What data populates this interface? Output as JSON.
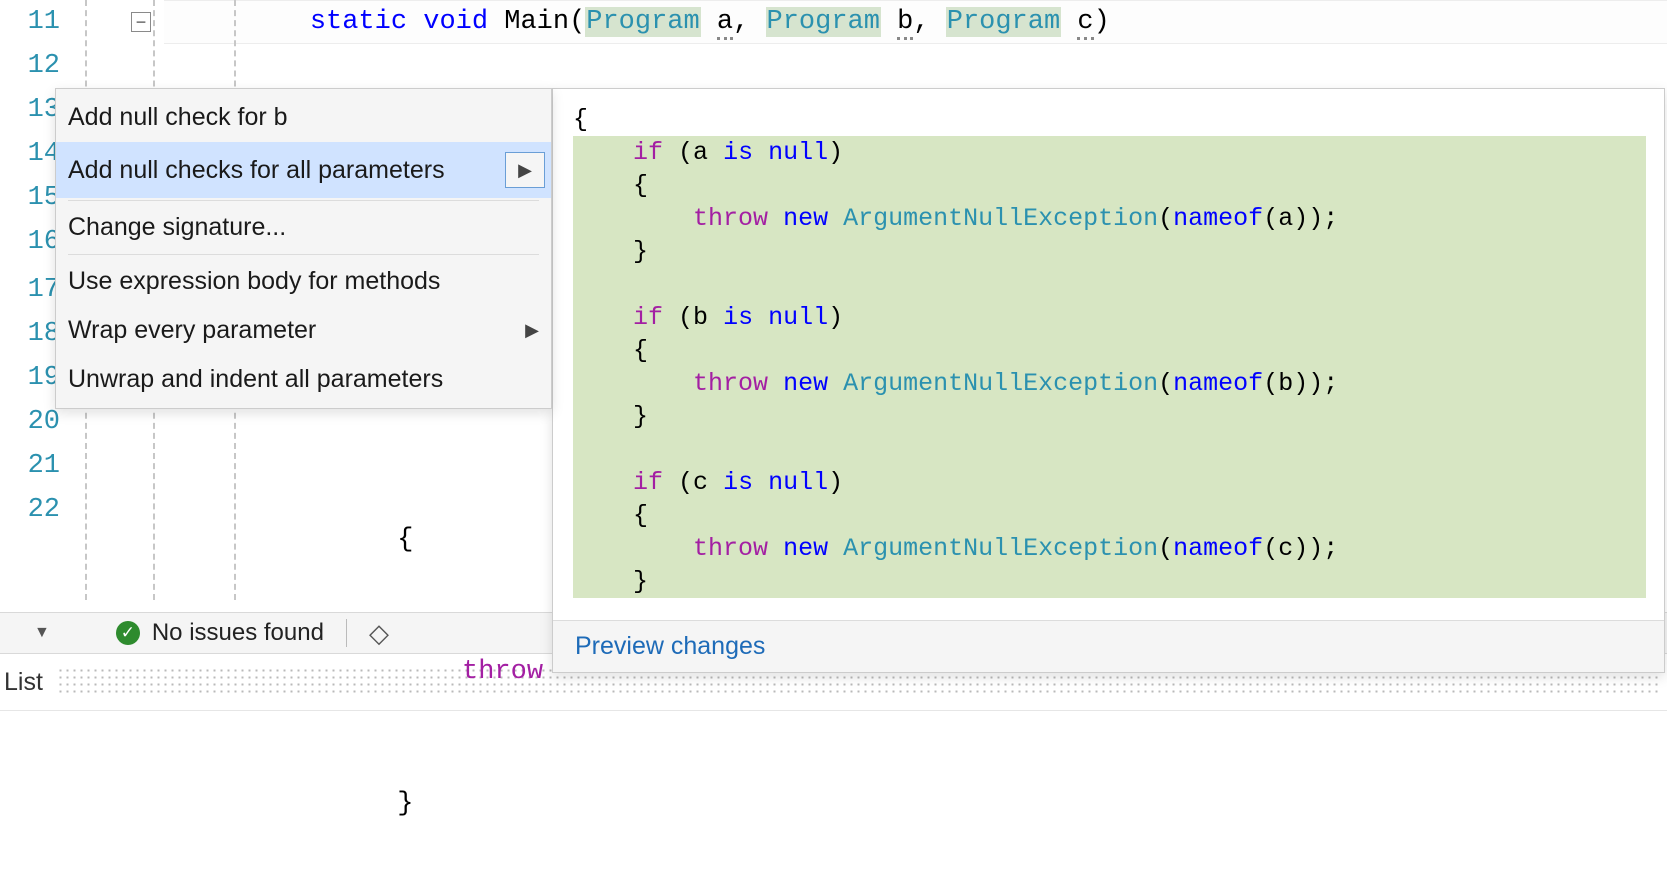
{
  "editor": {
    "line_numbers": [
      "11",
      "12",
      "13",
      "14",
      "15",
      "16",
      "17",
      "18",
      "19",
      "20",
      "21",
      "22"
    ],
    "fold_glyph": "−",
    "signature": {
      "prefix_static": "static",
      "prefix_void": "void",
      "method_name": "Main",
      "param_type": "Program",
      "params": [
        "a",
        "b",
        "c"
      ]
    },
    "behind_lines": {
      "l19": "{",
      "l20": "throw",
      "l21": "}"
    }
  },
  "quickfix": {
    "items": [
      {
        "label": "Add null check for b",
        "submenu": false
      },
      {
        "label": "Add null checks for all parameters",
        "submenu": true,
        "selected": true
      },
      {
        "label": "Change signature...",
        "submenu": false,
        "separator_before": true
      },
      {
        "label": "Use expression body for methods",
        "submenu": false,
        "separator_before": true
      },
      {
        "label": "Wrap every parameter",
        "submenu": true
      },
      {
        "label": "Unwrap and indent all parameters",
        "submenu": false
      }
    ]
  },
  "preview": {
    "open_brace": "{",
    "blocks": [
      {
        "param": "a"
      },
      {
        "param": "b"
      },
      {
        "param": "c"
      }
    ],
    "tokens": {
      "if": "if",
      "is": "is",
      "null": "null",
      "throw": "throw",
      "new": "new",
      "exception_type": "ArgumentNullException",
      "nameof": "nameof"
    },
    "ellipsis": "...",
    "footer_link": "Preview changes"
  },
  "status": {
    "issues_text": "No issues found"
  },
  "toolwindow": {
    "tab_label": "List"
  }
}
